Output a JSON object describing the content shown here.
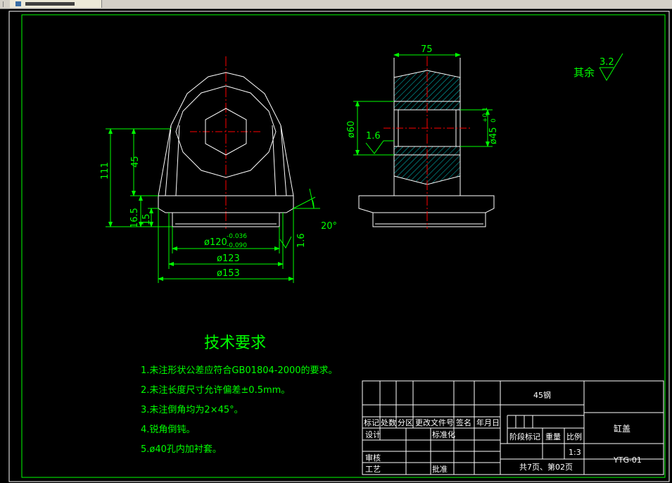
{
  "window": {
    "tab_icon": "drawing-file-icon"
  },
  "dims": {
    "d75": "75",
    "d111": "111",
    "d45": "45",
    "d165": "16.5",
    "d15": "15",
    "d120": "ø120",
    "tol120_upper": "-0.036",
    "tol120_lower": "-0.090",
    "d123": "ø123",
    "d153": "ø153",
    "a20": "20°",
    "r16a": "1.6",
    "r16b": "1.6",
    "d60": "ø60",
    "d45h": "ø45",
    "tol45_upper": "+0.1",
    "tol45_lower": "0"
  },
  "surface_finish": {
    "label": "其余",
    "value": "3.2"
  },
  "tech": {
    "title": "技术要求",
    "items": [
      "1.未注形状公差应符合GB01804-2000的要求。",
      "2.未注长度尺寸允许偏差±0.5mm。",
      "3.未注倒角均为2×45°。",
      "4.锐角倒钝。",
      "5.ø40孔内加衬套。"
    ]
  },
  "title_block": {
    "material": "45钢",
    "part_name": "缸盖",
    "drawing_no": "YTG-01",
    "scale": "1:3",
    "sheets": "共7页、第02页",
    "rev_headers": [
      "标记",
      "处数",
      "分区",
      "更改文件号",
      "签名",
      "年月日"
    ],
    "design": "设计",
    "standardize": "标准化",
    "stage_mark": "阶段标记",
    "weight": "重量",
    "scale_label": "比例",
    "review": "审核",
    "process": "工艺",
    "approve": "批准"
  },
  "colors": {
    "background": "#000000",
    "outline": "#ffffff",
    "dimension": "#00ff00",
    "centerline": "#ff0000",
    "hatch": "#00c8c8"
  }
}
